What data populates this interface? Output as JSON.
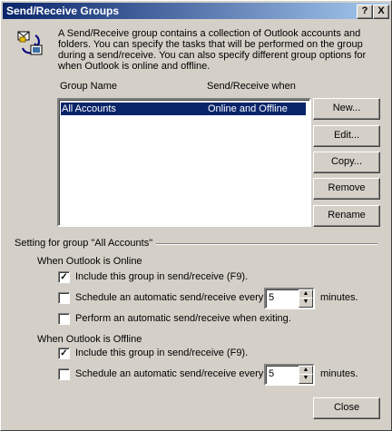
{
  "window": {
    "title": "Send/Receive Groups",
    "help_btn": "?",
    "close_btn": "X"
  },
  "description": "A Send/Receive group contains a collection of Outlook accounts and folders. You can specify the tasks that will be performed on the group during a send/receive. You can also specify different group options for when Outlook is online and offline.",
  "list": {
    "col_group": "Group Name",
    "col_when": "Send/Receive when",
    "rows": [
      {
        "name": "All Accounts",
        "when": "Online and Offline"
      }
    ]
  },
  "buttons": {
    "new": "New...",
    "edit": "Edit...",
    "copy": "Copy...",
    "remove": "Remove",
    "rename": "Rename",
    "close": "Close"
  },
  "setting_heading": "Setting for group \"All Accounts\"",
  "online": {
    "heading": "When Outlook is Online",
    "include_label": "Include this group in send/receive (F9).",
    "include_checked": true,
    "schedule_label": "Schedule an automatic send/receive every",
    "schedule_checked": false,
    "minutes_value": "5",
    "minutes_label": "minutes.",
    "exit_label": "Perform an automatic send/receive when exiting.",
    "exit_checked": false
  },
  "offline": {
    "heading": "When Outlook is Offline",
    "include_label": "Include this group in send/receive (F9).",
    "include_checked": true,
    "schedule_label": "Schedule an automatic send/receive every",
    "schedule_checked": false,
    "minutes_value": "5",
    "minutes_label": "minutes."
  },
  "icons": {
    "groups": "send-receive-groups-icon"
  }
}
